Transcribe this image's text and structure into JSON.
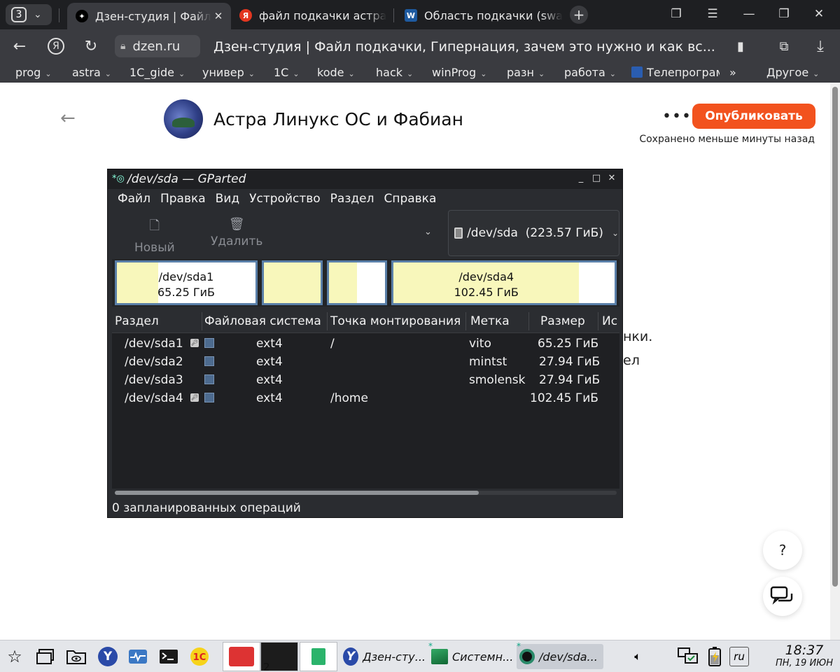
{
  "browser": {
    "tab_counter": "3",
    "tabs": [
      {
        "label": "Дзен-студия | Файл подкачки",
        "active": true
      },
      {
        "label": "файл подкачки астра линукс"
      },
      {
        "label": "Область подкачки (swap)"
      }
    ],
    "url_domain": "dzen.ru",
    "page_title": "Дзен-студия | Файл подкачки, Гипернация, зачем это нужно и как вс...",
    "bookmarks": [
      {
        "label": "prog"
      },
      {
        "label": "astra"
      },
      {
        "label": "1C_gide"
      },
      {
        "label": "универ"
      },
      {
        "label": "1С"
      },
      {
        "label": "kode"
      },
      {
        "label": "hack"
      },
      {
        "label": "winProg"
      },
      {
        "label": "разн"
      },
      {
        "label": "работа"
      },
      {
        "label": "Телепрограмма"
      }
    ],
    "bookmarks_more": "»",
    "bookmarks_other": "Другое"
  },
  "page": {
    "channel_name": "Астра Линукс ОС и Фабиан",
    "more_dots": "•••",
    "publish_label": "Опубликовать",
    "saved_note": "Сохранено меньше минуты назад",
    "fragment_1": "нки.",
    "fragment_2": "ел",
    "help_label": "?"
  },
  "gparted": {
    "title": "/dev/sda — GParted",
    "menu": [
      "Файл",
      "Правка",
      "Вид",
      "Устройство",
      "Раздел",
      "Справка"
    ],
    "toolbar": {
      "new_label": "Новый",
      "delete_label": "Удалить"
    },
    "device": "/dev/sda  (223.57 ГиБ)",
    "map": [
      {
        "name": "/dev/sda1",
        "size": "65.25 ГиБ",
        "used_fraction": 0.3
      },
      {
        "name": "",
        "size": "",
        "used_fraction": 1.0
      },
      {
        "name": "",
        "size": "",
        "used_fraction": 0.5
      },
      {
        "name": "/dev/sda4",
        "size": "102.45 ГиБ",
        "used_fraction": 0.84
      }
    ],
    "columns": [
      "Раздел",
      "Файловая система",
      "Точка монтирования",
      "Метка",
      "Размер",
      "Ис"
    ],
    "rows": [
      {
        "partition": "/dev/sda1",
        "locked": true,
        "fs": "ext4",
        "mount": "/",
        "label": "vito",
        "size": "65.25 ГиБ"
      },
      {
        "partition": "/dev/sda2",
        "locked": false,
        "fs": "ext4",
        "mount": "",
        "label": "mintst",
        "size": "27.94 ГиБ"
      },
      {
        "partition": "/dev/sda3",
        "locked": false,
        "fs": "ext4",
        "mount": "",
        "label": "smolensk",
        "size": "27.94 ГиБ"
      },
      {
        "partition": "/dev/sda4",
        "locked": true,
        "fs": "ext4",
        "mount": "/home",
        "label": "",
        "size": "102.45 ГиБ"
      }
    ],
    "status": "0 запланированных операций"
  },
  "taskbar": {
    "thumb_count": "2",
    "tasks": [
      {
        "label": "Дзен-сту..."
      },
      {
        "label": "Системн..."
      },
      {
        "label": "/dev/sda..."
      }
    ],
    "lang": "ru",
    "time": "18:37",
    "date": "ПН, 19 ИЮН"
  },
  "colors": {
    "publish": "#f2521e",
    "partition_used": "#f8f7bb",
    "partition_border": "#5a7fa8",
    "fs_ext4": "#4d6b8f"
  }
}
